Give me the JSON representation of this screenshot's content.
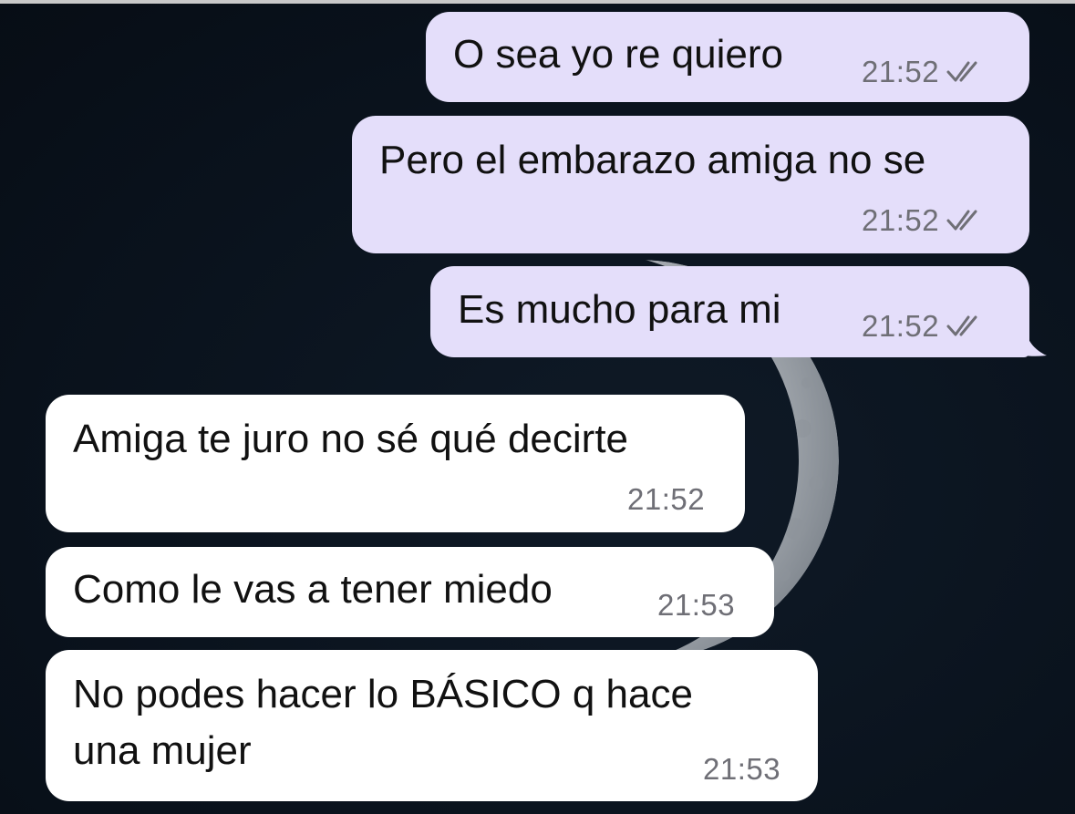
{
  "chat": {
    "messages": [
      {
        "direction": "outgoing",
        "text": "O sea yo re quiero",
        "time": "21:52",
        "status_icon": "double-check-icon"
      },
      {
        "direction": "outgoing",
        "text": "Pero el embarazo amiga no se",
        "time": "21:52",
        "status_icon": "double-check-icon"
      },
      {
        "direction": "outgoing",
        "text": "Es mucho para mi",
        "time": "21:52",
        "status_icon": "double-check-icon"
      },
      {
        "direction": "incoming",
        "text": "Amiga te juro no sé qué decirte",
        "time": "21:52"
      },
      {
        "direction": "incoming",
        "text": "Como le vas a tener miedo",
        "time": "21:53"
      },
      {
        "direction": "incoming",
        "text": "No podes hacer lo BÁSICO q hace\nuna mujer",
        "time": "21:53"
      }
    ]
  },
  "colors": {
    "outgoing_bubble": "#e4defa",
    "incoming_bubble": "#ffffff",
    "wallpaper": "#0b1420",
    "timestamp": "#6f6f76"
  },
  "wallpaper": {
    "icon": "crescent-moon-icon"
  }
}
